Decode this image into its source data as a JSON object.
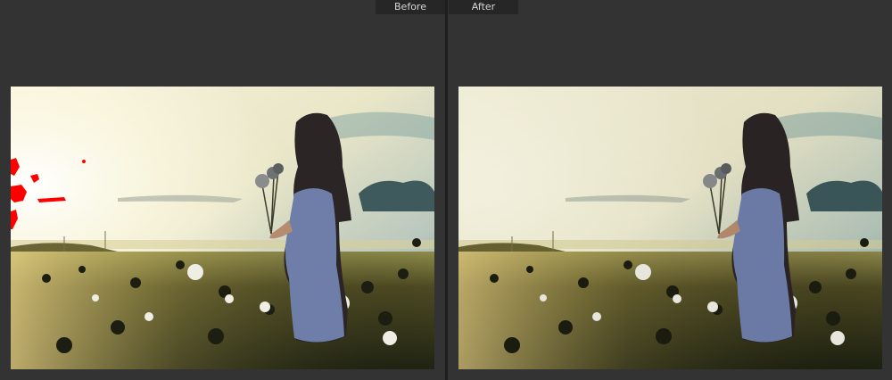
{
  "view": {
    "before_label": "Before",
    "after_label": "After"
  },
  "colors": {
    "background": "#333333",
    "label_bg": "#262626",
    "label_text": "#d6d6d6",
    "clipping_warning": "#ff0000"
  },
  "photos": {
    "before": {
      "icon": "photo-image",
      "clipping_overlay": true
    },
    "after": {
      "icon": "photo-image",
      "clipping_overlay": false
    }
  }
}
